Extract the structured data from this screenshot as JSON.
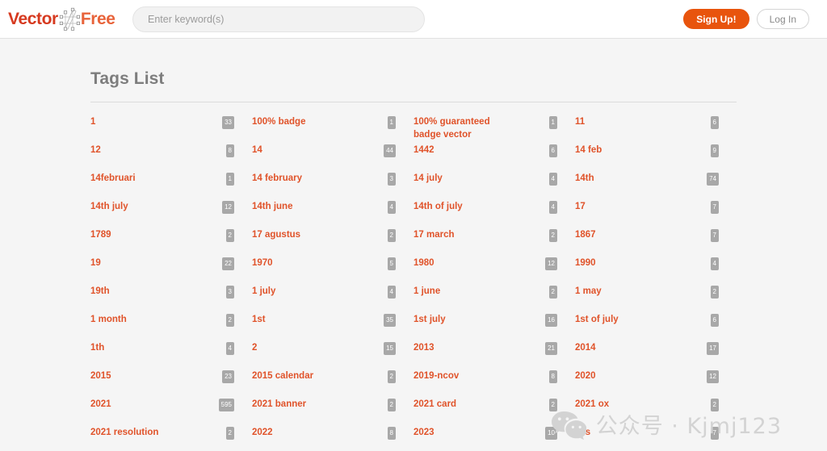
{
  "header": {
    "logo": {
      "part1": "Vector",
      "part2": "Free",
      "mark": "vector-pen-path-icon"
    },
    "search": {
      "value": "",
      "placeholder": "Enter keyword(s)"
    },
    "signup_label": "Sign Up!",
    "login_label": "Log In",
    "accent_color": "#e8540d"
  },
  "main": {
    "title": "Tags List",
    "tag_color": "#e0532a",
    "badge_color": "#a8a8a8",
    "tags": [
      {
        "name": "1",
        "count": "33"
      },
      {
        "name": "100% badge",
        "count": "1"
      },
      {
        "name": "100% guaranteed badge vector",
        "count": "1"
      },
      {
        "name": "11",
        "count": "6"
      },
      {
        "name": "12",
        "count": "8"
      },
      {
        "name": "14",
        "count": "44"
      },
      {
        "name": "1442",
        "count": "6"
      },
      {
        "name": "14 feb",
        "count": "9"
      },
      {
        "name": "14februari",
        "count": "1"
      },
      {
        "name": "14 february",
        "count": "3"
      },
      {
        "name": "14 july",
        "count": "4"
      },
      {
        "name": "14th",
        "count": "74"
      },
      {
        "name": "14th july",
        "count": "12"
      },
      {
        "name": "14th june",
        "count": "4"
      },
      {
        "name": "14th of july",
        "count": "4"
      },
      {
        "name": "17",
        "count": "7"
      },
      {
        "name": "1789",
        "count": "2"
      },
      {
        "name": "17 agustus",
        "count": "2"
      },
      {
        "name": "17 march",
        "count": "2"
      },
      {
        "name": "1867",
        "count": "7"
      },
      {
        "name": "19",
        "count": "22"
      },
      {
        "name": "1970",
        "count": "5"
      },
      {
        "name": "1980",
        "count": "12"
      },
      {
        "name": "1990",
        "count": "4"
      },
      {
        "name": "19th",
        "count": "3"
      },
      {
        "name": "1 july",
        "count": "4"
      },
      {
        "name": "1 june",
        "count": "2"
      },
      {
        "name": "1 may",
        "count": "2"
      },
      {
        "name": "1 month",
        "count": "2"
      },
      {
        "name": "1st",
        "count": "35"
      },
      {
        "name": "1st july",
        "count": "16"
      },
      {
        "name": "1st of july",
        "count": "6"
      },
      {
        "name": "1th",
        "count": "4"
      },
      {
        "name": "2",
        "count": "15"
      },
      {
        "name": "2013",
        "count": "21"
      },
      {
        "name": "2014",
        "count": "17"
      },
      {
        "name": "2015",
        "count": "23"
      },
      {
        "name": "2015 calendar",
        "count": "2"
      },
      {
        "name": "2019-ncov",
        "count": "8"
      },
      {
        "name": "2020",
        "count": "12"
      },
      {
        "name": "2021",
        "count": "595"
      },
      {
        "name": "2021 banner",
        "count": "2"
      },
      {
        "name": "2021 card",
        "count": "2"
      },
      {
        "name": "2021 ox",
        "count": "2"
      },
      {
        "name": "2021 resolution",
        "count": "2"
      },
      {
        "name": "2022",
        "count": "8"
      },
      {
        "name": "2023",
        "count": "10"
      },
      {
        "name": "20s",
        "count": "7"
      }
    ]
  },
  "watermark": {
    "text": "公众号 · Kjmj123",
    "icon": "wechat-icon"
  }
}
